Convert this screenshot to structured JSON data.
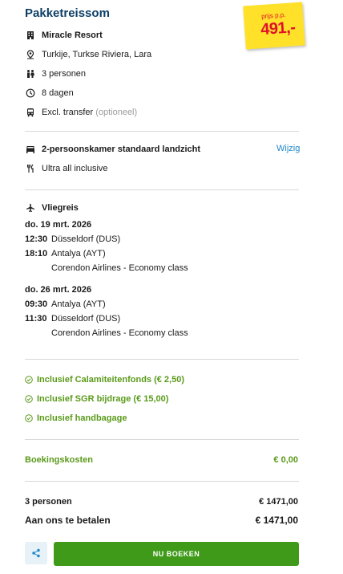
{
  "title": "Pakketreissom",
  "price": {
    "label": "prijs p.p.",
    "value": "491,-"
  },
  "details": {
    "hotel": "Miracle Resort",
    "location": "Turkije, Turkse Riviera, Lara",
    "persons": "3 personen",
    "days": "8 dagen",
    "transfer": "Excl. transfer",
    "transfer_note": "(optioneel)"
  },
  "room": {
    "name": "2-persoonskamer standaard landzicht",
    "change_label": "Wijzig",
    "board": "Ultra all inclusive"
  },
  "flight": {
    "heading": "Vliegreis",
    "outbound": {
      "date": "do. 19 mrt. 2026",
      "dep_time": "12:30",
      "dep_place": "Düsseldorf (DUS)",
      "arr_time": "18:10",
      "arr_place": "Antalya (AYT)",
      "airline": "Corendon Airlines - Economy class"
    },
    "return": {
      "date": "do. 26 mrt. 2026",
      "dep_time": "09:30",
      "dep_place": "Antalya (AYT)",
      "arr_time": "11:30",
      "arr_place": "Düsseldorf (DUS)",
      "airline": "Corendon Airlines - Economy class"
    }
  },
  "inclusions": [
    "Inclusief Calamiteitenfonds (€ 2,50)",
    "Inclusief SGR bijdrage (€ 15,00)",
    "Inclusief handbagage"
  ],
  "booking_costs": {
    "label": "Boekingskosten",
    "value": "€ 0,00"
  },
  "totals": {
    "persons_label": "3 personen",
    "persons_value": "€ 1471,00",
    "pay_label": "Aan ons te betalen",
    "pay_value": "€ 1471,00"
  },
  "actions": {
    "book_label": "NU BOEKEN"
  },
  "colors": {
    "brand_blue": "#0d3f66",
    "link": "#1e88c8",
    "green": "#3e9a18",
    "price_red": "#e0112b",
    "price_yellow": "#ffe12a"
  }
}
